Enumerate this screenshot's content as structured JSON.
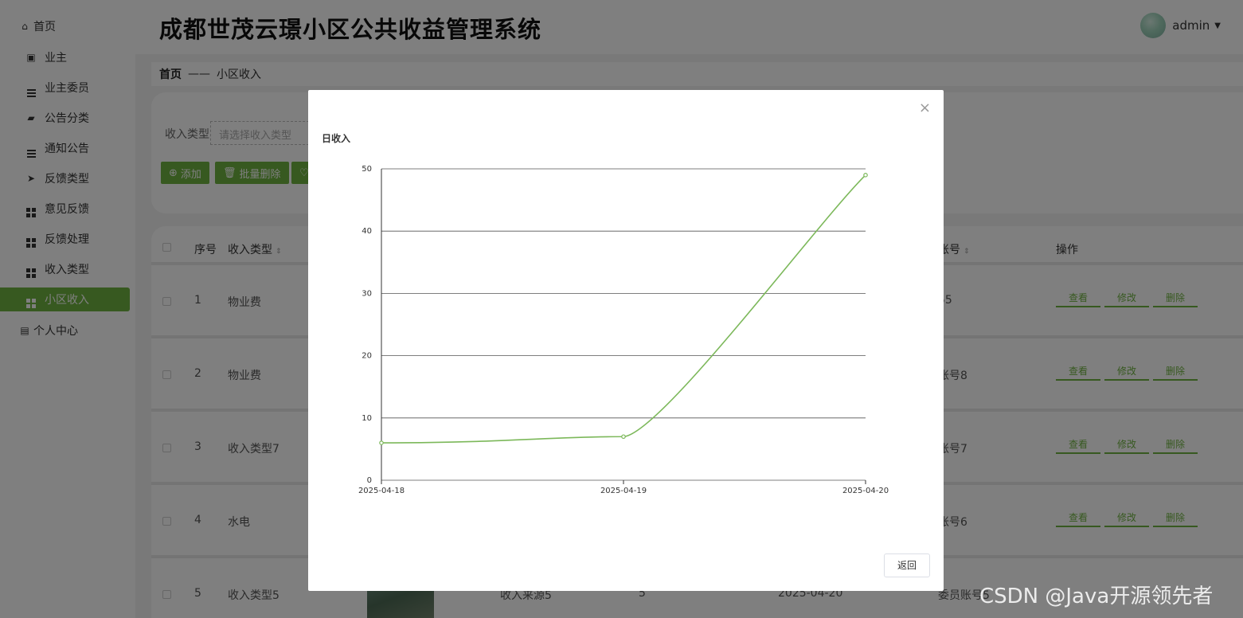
{
  "app": {
    "title": "成都世茂云璟小区公共收益管理系统"
  },
  "user": {
    "name": "admin"
  },
  "sidebar": {
    "items": [
      {
        "label": "首页"
      },
      {
        "label": "业主"
      },
      {
        "label": "业主委员"
      },
      {
        "label": "公告分类"
      },
      {
        "label": "通知公告"
      },
      {
        "label": "反馈类型"
      },
      {
        "label": "意见反馈"
      },
      {
        "label": "反馈处理"
      },
      {
        "label": "收入类型"
      },
      {
        "label": "小区收入"
      },
      {
        "label": "个人中心"
      }
    ]
  },
  "breadcrumb": {
    "home": "首页",
    "sep": "——",
    "current": "小区收入"
  },
  "search": {
    "label": "收入类型",
    "placeholder": "请选择收入类型"
  },
  "toolbar": {
    "add": "添加",
    "batch_delete": "批量删除"
  },
  "table": {
    "headers": {
      "index": "序号",
      "type": "收入类型",
      "account": "账号",
      "actions": "操作"
    },
    "rows": [
      {
        "index": "1",
        "type": "物业费",
        "account": "55"
      },
      {
        "index": "2",
        "type": "物业费",
        "account": "账号8"
      },
      {
        "index": "3",
        "type": "收入类型7",
        "account": "账号7"
      },
      {
        "index": "4",
        "type": "水电",
        "account": "账号6"
      },
      {
        "index": "5",
        "type": "收入类型5",
        "source": "收入来源5",
        "amount": "5",
        "date": "2025-04-20",
        "account": "委员账号5"
      }
    ],
    "ops": {
      "view": "查看",
      "edit": "修改",
      "delete": "删除"
    }
  },
  "modal": {
    "close": "×",
    "back": "返回"
  },
  "chart_data": {
    "type": "line",
    "title": "日收入",
    "x": [
      "2025-04-18",
      "2025-04-19",
      "2025-04-20"
    ],
    "series": [
      {
        "values": [
          6,
          7,
          49
        ],
        "color": "#7cb85a"
      }
    ],
    "ylim": [
      0,
      50
    ],
    "yticks": [
      0,
      10,
      20,
      30,
      40,
      50
    ],
    "grid": true,
    "smooth": true
  },
  "watermark": "CSDN @Java开源领先者"
}
